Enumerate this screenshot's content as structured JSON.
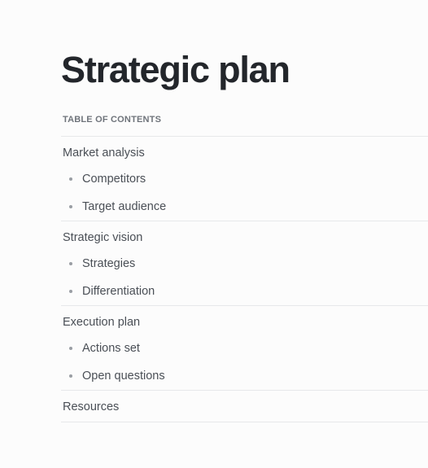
{
  "page": {
    "title": "Strategic plan"
  },
  "toc": {
    "label": "TABLE OF CONTENTS",
    "sections": [
      {
        "label": "Market analysis",
        "items": [
          "Competitors",
          "Target audience"
        ]
      },
      {
        "label": "Strategic vision",
        "items": [
          "Strategies",
          "Differentiation"
        ]
      },
      {
        "label": "Execution plan",
        "items": [
          "Actions set",
          "Open questions"
        ]
      },
      {
        "label": "Resources",
        "items": []
      }
    ]
  },
  "colors": {
    "background": "#fcfcfc",
    "title": "#23262b",
    "text": "#4a4f56",
    "muted": "#6f747b",
    "divider": "#e7e8ea",
    "bullet": "#9a9ea4"
  }
}
